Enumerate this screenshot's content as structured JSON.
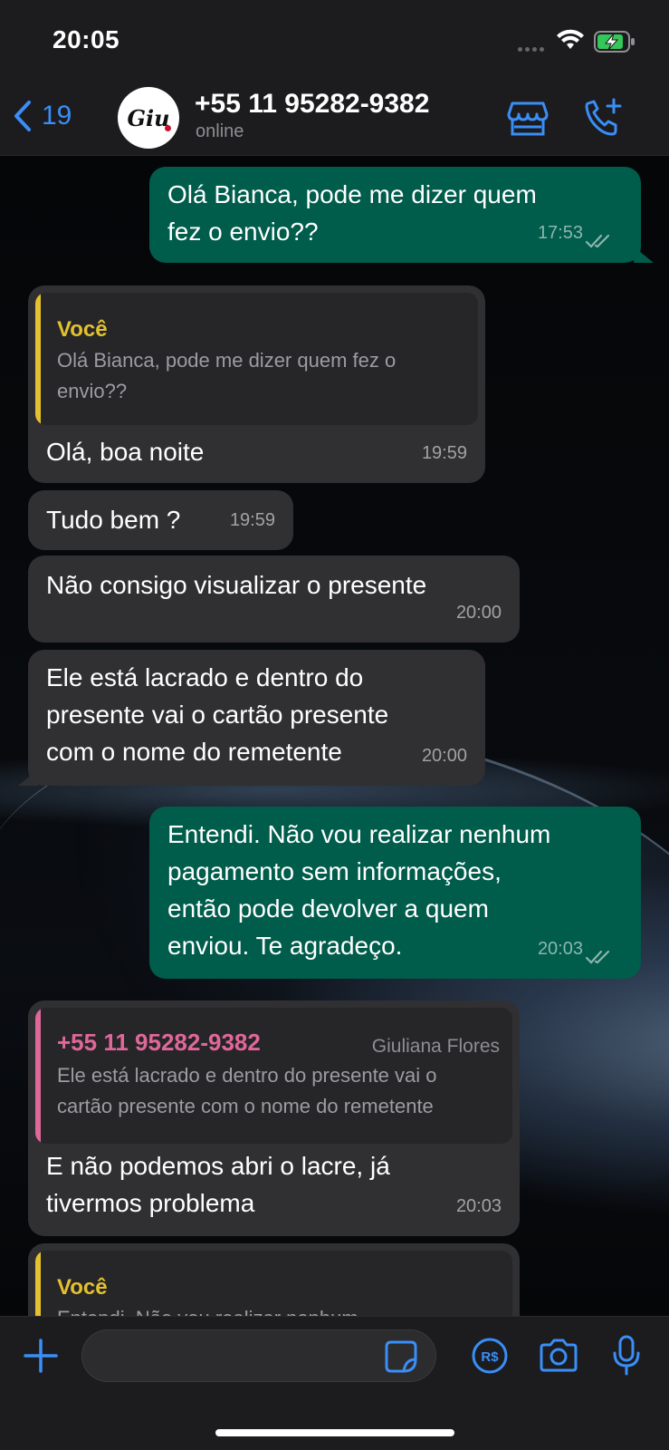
{
  "status_bar": {
    "time": "20:05"
  },
  "header": {
    "back_count": "19",
    "avatar_text": "Giu",
    "contact_name": "+55 11 95282-9382",
    "contact_status": "online"
  },
  "messages": [
    {
      "direction": "out",
      "text_lines": [
        "Olá Bianca, pode me dizer quem",
        "fez o envio??"
      ],
      "time": "17:53",
      "read": true
    },
    {
      "direction": "in",
      "quote": {
        "author": "Você",
        "text_lines": [
          "Olá Bianca, pode me dizer quem fez o",
          "envio??"
        ]
      },
      "text": "Olá, boa noite",
      "time": "19:59"
    },
    {
      "direction": "in",
      "text": "Tudo bem ?",
      "time": "19:59"
    },
    {
      "direction": "in",
      "text": "Não consigo visualizar o presente",
      "time": "20:00"
    },
    {
      "direction": "in",
      "text_lines": [
        "Ele está lacrado e dentro do",
        "presente vai o cartão presente",
        "com o nome do remetente"
      ],
      "time": "20:00"
    },
    {
      "direction": "out",
      "text_lines": [
        "Entendi. Não vou realizar nenhum",
        "pagamento sem informações,",
        "então pode devolver a quem",
        "enviou. Te agradeço."
      ],
      "time": "20:03",
      "read": true
    },
    {
      "direction": "in",
      "quote": {
        "author": "+55 11 95282-9382",
        "name": "Giuliana Flores",
        "text_lines": [
          "Ele está lacrado e dentro do presente vai o",
          "cartão presente com o nome do remetente"
        ]
      },
      "text_lines": [
        "E não podemos abri o lacre, já",
        "tivermos problema"
      ],
      "time": "20:03"
    },
    {
      "direction": "in",
      "quote": {
        "author": "Você",
        "text_lines": [
          "Entendi. Não vou realizar nenhum"
        ]
      }
    }
  ],
  "colors": {
    "accent": "#3a8ef7",
    "outgoing_bubble": "#005c4b",
    "incoming_bubble": "#303033",
    "quote_self": "#e4c12f",
    "quote_contact": "#e0679a"
  },
  "composer": {
    "placeholder": ""
  },
  "icons": [
    "chevron-left-icon",
    "store-icon",
    "add-call-icon",
    "plus-icon",
    "sticker-icon",
    "payment-icon",
    "camera-icon",
    "microphone-icon",
    "double-check-icon",
    "wifi-icon",
    "battery-charging-icon"
  ]
}
